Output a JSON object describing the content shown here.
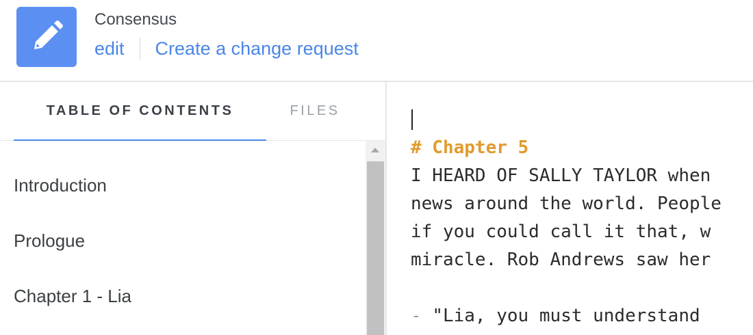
{
  "header": {
    "title": "Consensus",
    "links": {
      "edit": "edit",
      "change_request": "Create a change request"
    },
    "icon": "pencil-icon",
    "icon_bg": "#5b8ff2",
    "link_color": "#4a86e8"
  },
  "sidebar": {
    "tabs": {
      "toc": "TABLE OF CONTENTS",
      "files": "FILES"
    },
    "active_tab": "TABLE OF CONTENTS",
    "items": [
      "Introduction",
      "Prologue",
      "Chapter 1 - Lia"
    ]
  },
  "editor": {
    "lines": [
      "# Chapter 5",
      "I HEARD OF SALLY TAYLOR when",
      "news around the world. People",
      "if you could call it that, w",
      "miracle. Rob Andrews saw her",
      "",
      "\"Lia, you must understand"
    ],
    "bullet": "-",
    "heading_color": "#e09b2c"
  }
}
